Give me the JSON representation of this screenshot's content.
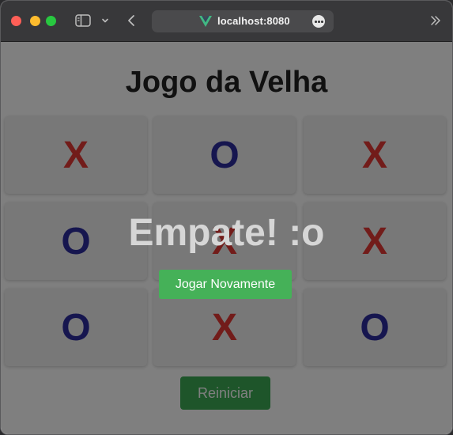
{
  "browser": {
    "url": "localhost:8080"
  },
  "game": {
    "title": "Jogo da Velha",
    "board": [
      "X",
      "O",
      "X",
      "O",
      "X",
      "X",
      "O",
      "X",
      "O"
    ],
    "reset_label": "Reiniciar"
  },
  "overlay": {
    "message": "Empate! :o",
    "play_again_label": "Jogar Novamente"
  },
  "colors": {
    "x_mark": "#e53935",
    "o_mark": "#2c2c9e",
    "button_green": "#3cab55"
  }
}
